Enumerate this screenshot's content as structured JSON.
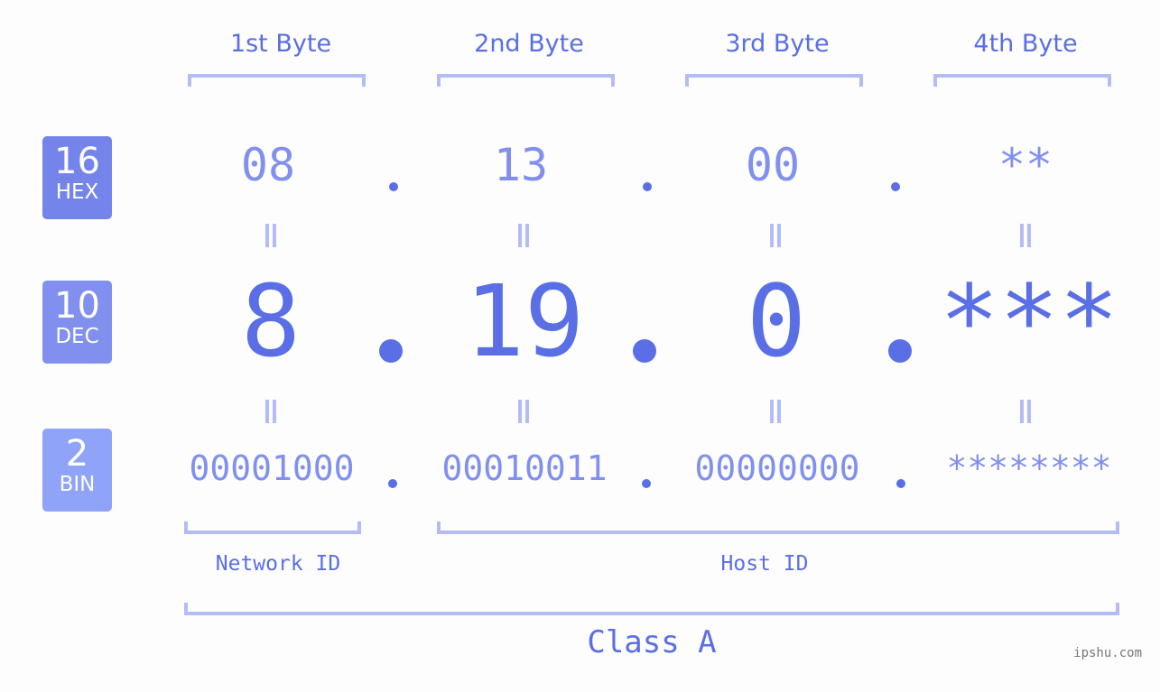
{
  "bytes": [
    {
      "label": "1st Byte",
      "hex": "08",
      "dec": "8",
      "bin": "00001000"
    },
    {
      "label": "2nd Byte",
      "hex": "13",
      "dec": "19",
      "bin": "00010011"
    },
    {
      "label": "3rd Byte",
      "hex": "00",
      "dec": "0",
      "bin": "00000000"
    },
    {
      "label": "4th Byte",
      "hex": "**",
      "dec": "***",
      "bin": "********"
    }
  ],
  "badges": {
    "hex": {
      "num": "16",
      "base": "HEX",
      "color": "#7584eb"
    },
    "dec": {
      "num": "10",
      "base": "DEC",
      "color": "#8190ee"
    },
    "bin": {
      "num": "2",
      "base": "BIN",
      "color": "#8fa3f8"
    }
  },
  "network_id_label": "Network ID",
  "host_id_label": "Host ID",
  "class_label": "Class A",
  "watermark": "ipshu.com",
  "colors": {
    "primary": "#5a6ee6",
    "secondary": "#8190ee",
    "bracket": "#b3bcf6"
  }
}
